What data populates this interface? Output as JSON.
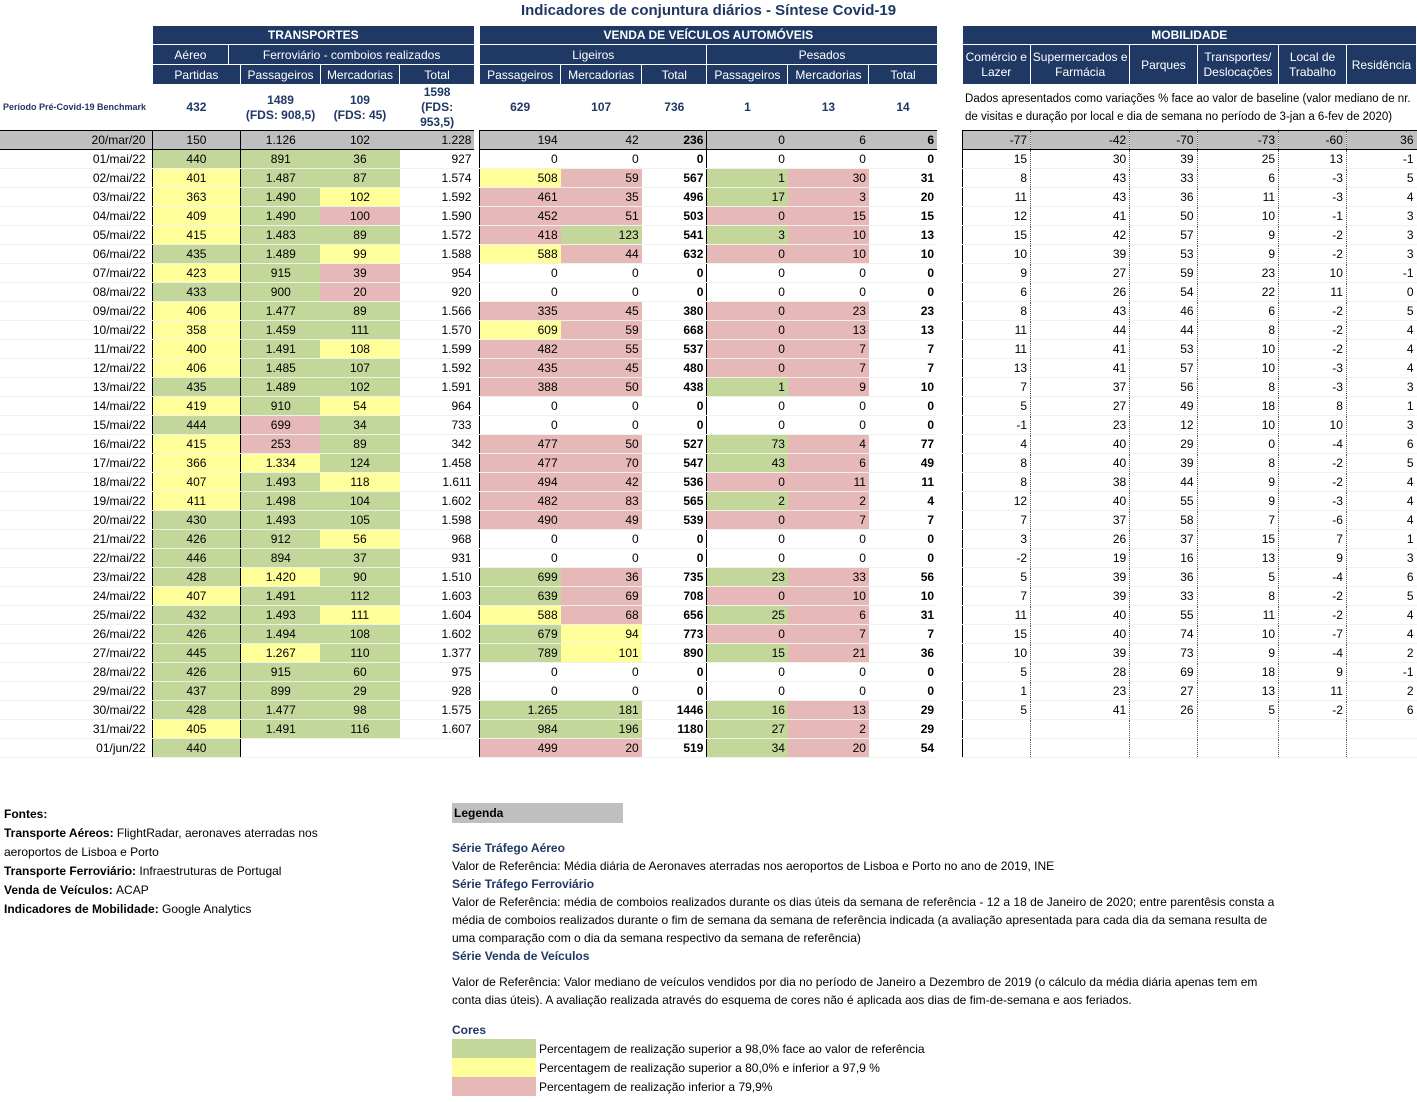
{
  "title": "Indicadores de conjuntura diários - Síntese Covid-19",
  "sections": {
    "transportes": "TRANSPORTES",
    "vendas": "VENDA DE VEÍCULOS AUTOMÓVEIS",
    "mobilidade": "MOBILIDADE"
  },
  "subheaders": {
    "aereo": "Aéreo",
    "ferroviario": "Ferroviário - comboios realizados",
    "ligeiros": "Ligeiros",
    "pesados": "Pesados"
  },
  "columns": {
    "partidas": "Partidas",
    "passageiros": "Passageiros",
    "mercadorias": "Mercadorias",
    "total": "Total",
    "comercio": "Comércio e Lazer",
    "supermercados": "Supermercados e Farmácia",
    "parques": "Parques",
    "transportes_desl": "Transportes/ Deslocações",
    "local_trabalho": "Local de Trabalho",
    "residencia": "Residência"
  },
  "benchmark": {
    "label": "Período Pré-Covid-19 Benchmark",
    "values": [
      "432",
      "1489\n(FDS: 908,5)",
      "109\n(FDS: 45)",
      "1598\n(FDS: 953,5)",
      "629",
      "107",
      "736",
      "1",
      "13",
      "14"
    ],
    "note": "Dados apresentados como variações % face ao valor de baseline (valor mediano de nr. de visitas e duração por local e dia de semana no período de 3-jan a 6-fev de 2020)"
  },
  "reference_row": {
    "date": "20/mar/20",
    "values": [
      "150",
      "1.126",
      "102",
      "1.228",
      "194",
      "42",
      "236",
      "0",
      "6",
      "6",
      "-77",
      "-42",
      "-70",
      "-73",
      "-60",
      "36"
    ]
  },
  "rows": [
    {
      "d": "01/mai/22",
      "v": [
        "440",
        "891",
        "36",
        "927",
        "0",
        "0",
        "0",
        "0",
        "0",
        "0",
        "15",
        "30",
        "39",
        "25",
        "13",
        "-1"
      ],
      "c": "g,g,g,,,,,,,"
    },
    {
      "d": "02/mai/22",
      "v": [
        "401",
        "1.487",
        "87",
        "1.574",
        "508",
        "59",
        "567",
        "1",
        "30",
        "31",
        "8",
        "43",
        "33",
        "6",
        "-3",
        "5"
      ],
      "c": "y,g,g,,y,r,,g,r,"
    },
    {
      "d": "03/mai/22",
      "v": [
        "363",
        "1.490",
        "102",
        "1.592",
        "461",
        "35",
        "496",
        "17",
        "3",
        "20",
        "11",
        "43",
        "36",
        "11",
        "-3",
        "4"
      ],
      "c": "y,g,y,,r,r,,g,r,"
    },
    {
      "d": "04/mai/22",
      "v": [
        "409",
        "1.490",
        "100",
        "1.590",
        "452",
        "51",
        "503",
        "0",
        "15",
        "15",
        "12",
        "41",
        "50",
        "10",
        "-1",
        "3"
      ],
      "c": "y,g,r,,r,r,,r,r,"
    },
    {
      "d": "05/mai/22",
      "v": [
        "415",
        "1.483",
        "89",
        "1.572",
        "418",
        "123",
        "541",
        "3",
        "10",
        "13",
        "15",
        "42",
        "57",
        "9",
        "-2",
        "3"
      ],
      "c": "y,g,g,,r,g,,g,r,"
    },
    {
      "d": "06/mai/22",
      "v": [
        "435",
        "1.489",
        "99",
        "1.588",
        "588",
        "44",
        "632",
        "0",
        "10",
        "10",
        "10",
        "39",
        "53",
        "9",
        "-2",
        "3"
      ],
      "c": "g,g,y,,y,r,,r,r,"
    },
    {
      "d": "07/mai/22",
      "v": [
        "423",
        "915",
        "39",
        "954",
        "0",
        "0",
        "0",
        "0",
        "0",
        "0",
        "9",
        "27",
        "59",
        "23",
        "10",
        "-1"
      ],
      "c": "y,g,r,,,,,,,"
    },
    {
      "d": "08/mai/22",
      "v": [
        "433",
        "900",
        "20",
        "920",
        "0",
        "0",
        "0",
        "0",
        "0",
        "0",
        "6",
        "26",
        "54",
        "22",
        "11",
        "0"
      ],
      "c": "g,g,r,,,,,,,"
    },
    {
      "d": "09/mai/22",
      "v": [
        "406",
        "1.477",
        "89",
        "1.566",
        "335",
        "45",
        "380",
        "0",
        "23",
        "23",
        "8",
        "43",
        "46",
        "6",
        "-2",
        "5"
      ],
      "c": "y,g,g,,r,r,,r,r,"
    },
    {
      "d": "10/mai/22",
      "v": [
        "358",
        "1.459",
        "111",
        "1.570",
        "609",
        "59",
        "668",
        "0",
        "13",
        "13",
        "11",
        "44",
        "44",
        "8",
        "-2",
        "4"
      ],
      "c": "y,g,g,,y,r,,r,r,"
    },
    {
      "d": "11/mai/22",
      "v": [
        "400",
        "1.491",
        "108",
        "1.599",
        "482",
        "55",
        "537",
        "0",
        "7",
        "7",
        "11",
        "41",
        "53",
        "10",
        "-2",
        "4"
      ],
      "c": "y,g,y,,r,r,,r,r,"
    },
    {
      "d": "12/mai/22",
      "v": [
        "406",
        "1.485",
        "107",
        "1.592",
        "435",
        "45",
        "480",
        "0",
        "7",
        "7",
        "13",
        "41",
        "57",
        "10",
        "-3",
        "4"
      ],
      "c": "y,g,g,,r,r,,r,r,"
    },
    {
      "d": "13/mai/22",
      "v": [
        "435",
        "1.489",
        "102",
        "1.591",
        "388",
        "50",
        "438",
        "1",
        "9",
        "10",
        "7",
        "37",
        "56",
        "8",
        "-3",
        "3"
      ],
      "c": "g,g,g,,r,r,,g,r,"
    },
    {
      "d": "14/mai/22",
      "v": [
        "419",
        "910",
        "54",
        "964",
        "0",
        "0",
        "0",
        "0",
        "0",
        "0",
        "5",
        "27",
        "49",
        "18",
        "8",
        "1"
      ],
      "c": "y,g,y,,,,,,,"
    },
    {
      "d": "15/mai/22",
      "v": [
        "444",
        "699",
        "34",
        "733",
        "0",
        "0",
        "0",
        "0",
        "0",
        "0",
        "-1",
        "23",
        "12",
        "10",
        "10",
        "3"
      ],
      "c": "g,r,g,,,,,,,"
    },
    {
      "d": "16/mai/22",
      "v": [
        "415",
        "253",
        "89",
        "342",
        "477",
        "50",
        "527",
        "73",
        "4",
        "77",
        "4",
        "40",
        "29",
        "0",
        "-4",
        "6"
      ],
      "c": "y,r,g,,r,r,,g,r,"
    },
    {
      "d": "17/mai/22",
      "v": [
        "366",
        "1.334",
        "124",
        "1.458",
        "477",
        "70",
        "547",
        "43",
        "6",
        "49",
        "8",
        "40",
        "39",
        "8",
        "-2",
        "5"
      ],
      "c": "y,y,g,,r,r,,g,r,"
    },
    {
      "d": "18/mai/22",
      "v": [
        "407",
        "1.493",
        "118",
        "1.611",
        "494",
        "42",
        "536",
        "0",
        "11",
        "11",
        "8",
        "38",
        "44",
        "9",
        "-2",
        "4"
      ],
      "c": "y,g,y,,r,r,,r,r,"
    },
    {
      "d": "19/mai/22",
      "v": [
        "411",
        "1.498",
        "104",
        "1.602",
        "482",
        "83",
        "565",
        "2",
        "2",
        "4",
        "12",
        "40",
        "55",
        "9",
        "-3",
        "4"
      ],
      "c": "y,g,g,,r,r,,g,r,"
    },
    {
      "d": "20/mai/22",
      "v": [
        "430",
        "1.493",
        "105",
        "1.598",
        "490",
        "49",
        "539",
        "0",
        "7",
        "7",
        "7",
        "37",
        "58",
        "7",
        "-6",
        "4"
      ],
      "c": "g,g,g,,r,r,,r,r,"
    },
    {
      "d": "21/mai/22",
      "v": [
        "426",
        "912",
        "56",
        "968",
        "0",
        "0",
        "0",
        "0",
        "0",
        "0",
        "3",
        "26",
        "37",
        "15",
        "7",
        "1"
      ],
      "c": "g,g,y,,,,,,,"
    },
    {
      "d": "22/mai/22",
      "v": [
        "446",
        "894",
        "37",
        "931",
        "0",
        "0",
        "0",
        "0",
        "0",
        "0",
        "-2",
        "19",
        "16",
        "13",
        "9",
        "3"
      ],
      "c": "g,g,g,,,,,,,"
    },
    {
      "d": "23/mai/22",
      "v": [
        "428",
        "1.420",
        "90",
        "1.510",
        "699",
        "36",
        "735",
        "23",
        "33",
        "56",
        "5",
        "39",
        "36",
        "5",
        "-4",
        "6"
      ],
      "c": "g,y,g,,g,r,,g,r,"
    },
    {
      "d": "24/mai/22",
      "v": [
        "407",
        "1.491",
        "112",
        "1.603",
        "639",
        "69",
        "708",
        "0",
        "10",
        "10",
        "7",
        "39",
        "33",
        "8",
        "-2",
        "5"
      ],
      "c": "y,g,g,,g,r,,r,r,"
    },
    {
      "d": "25/mai/22",
      "v": [
        "432",
        "1.493",
        "111",
        "1.604",
        "588",
        "68",
        "656",
        "25",
        "6",
        "31",
        "11",
        "40",
        "55",
        "11",
        "-2",
        "4"
      ],
      "c": "g,g,y,,y,r,,g,r,"
    },
    {
      "d": "26/mai/22",
      "v": [
        "426",
        "1.494",
        "108",
        "1.602",
        "679",
        "94",
        "773",
        "0",
        "7",
        "7",
        "15",
        "40",
        "74",
        "10",
        "-7",
        "4"
      ],
      "c": "g,g,g,,g,y,,r,r,"
    },
    {
      "d": "27/mai/22",
      "v": [
        "445",
        "1.267",
        "110",
        "1.377",
        "789",
        "101",
        "890",
        "15",
        "21",
        "36",
        "10",
        "39",
        "73",
        "9",
        "-4",
        "2"
      ],
      "c": "g,y,g,,g,y,,g,r,"
    },
    {
      "d": "28/mai/22",
      "v": [
        "426",
        "915",
        "60",
        "975",
        "0",
        "0",
        "0",
        "0",
        "0",
        "0",
        "5",
        "28",
        "69",
        "18",
        "9",
        "-1"
      ],
      "c": "g,g,g,,,,,,,"
    },
    {
      "d": "29/mai/22",
      "v": [
        "437",
        "899",
        "29",
        "928",
        "0",
        "0",
        "0",
        "0",
        "0",
        "0",
        "1",
        "23",
        "27",
        "13",
        "11",
        "2"
      ],
      "c": "g,g,g,,,,,,,"
    },
    {
      "d": "30/mai/22",
      "v": [
        "428",
        "1.477",
        "98",
        "1.575",
        "1.265",
        "181",
        "1446",
        "16",
        "13",
        "29",
        "5",
        "41",
        "26",
        "5",
        "-2",
        "6"
      ],
      "c": "g,g,g,,g,g,,g,r,"
    },
    {
      "d": "31/mai/22",
      "v": [
        "405",
        "1.491",
        "116",
        "1.607",
        "984",
        "196",
        "1180",
        "27",
        "2",
        "29",
        "",
        "",
        "",
        "",
        "",
        ""
      ],
      "c": "y,g,g,,g,g,,g,r,"
    },
    {
      "d": "01/jun/22",
      "v": [
        "440",
        "",
        "",
        "",
        "499",
        "20",
        "519",
        "34",
        "20",
        "54",
        "",
        "",
        "",
        "",
        "",
        ""
      ],
      "c": "g,,,,r,r,,g,r,"
    }
  ],
  "sources": [
    {
      "k": "Fontes:",
      "t": ""
    },
    {
      "k": "Transporte Aéreos: ",
      "t": "FlightRadar, aeronaves aterradas nos aeroportos de Lisboa e Porto"
    },
    {
      "k": "Transporte Ferroviário: ",
      "t": "Infraestruturas de Portugal"
    },
    {
      "k": "Venda de Veículos: ",
      "t": "ACAP"
    },
    {
      "k": "Indicadores de Mobilidade: ",
      "t": "Google Analytics"
    }
  ],
  "legend": {
    "title": "Legenda",
    "aereo_h": "Série Tráfego Aéreo",
    "aereo_t": "Valor de Referência: Média diária de Aeronaves aterradas nos aeroportos de Lisboa e Porto no ano de 2019, INE",
    "ferro_h": "Série Tráfego Ferroviário",
    "ferro_t": "Valor de Referência: média de comboios realizados durante os dias úteis da semana de referência - 12 a 18 de Janeiro de 2020; entre parentêsis consta a média de comboios realizados durante o fim de semana da semana de referência indicada (a avaliação apresentada para cada dia da semana resulta de uma comparação com o dia da semana respectivo da semana de referência)",
    "veic_h": "Série Venda de Veículos",
    "veic_t": "Valor de Referência: Valor mediano de veículos vendidos por dia no período de Janeiro a Dezembro de 2019 (o cálculo da média diária apenas tem em conta dias úteis). A avaliação realizada através do esquema de cores não é aplicada aos dias de fim-de-semana e aos feriados.",
    "cores_h": "Cores",
    "green": "Percentagem de realização superior a 98,0% face ao valor de referência",
    "yellow": "Percentagem de realização superior a 80,0% e inferior a 97,9 %",
    "red": "Percentagem de realização inferior a 79,9%",
    "colors": {
      "green": "#c4d79b",
      "yellow": "#ffff99",
      "red": "#e6b8b7",
      "header": "#1f3864"
    }
  }
}
